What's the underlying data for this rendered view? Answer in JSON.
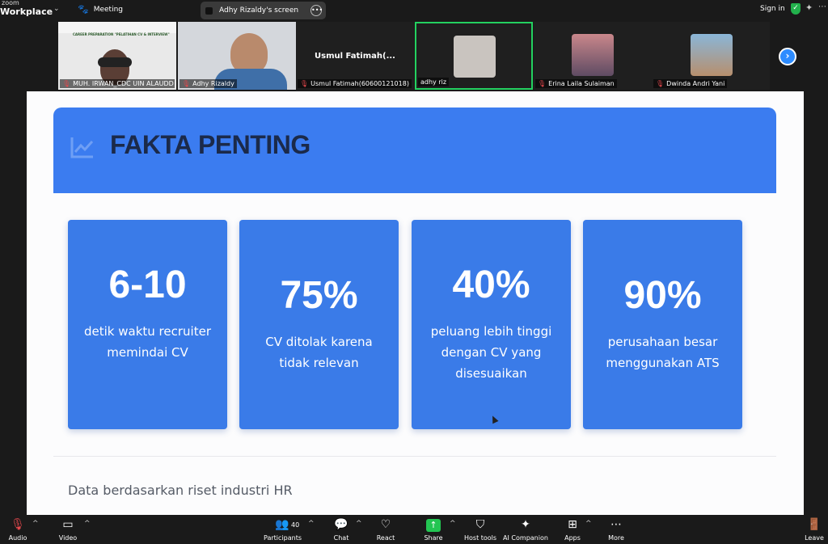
{
  "app": {
    "brand_line1": "zoom",
    "brand_line2": "Workplace",
    "meeting_label": "Meeting",
    "screen_label": "Adhy Rizaldy's screen",
    "sign_in": "Sign in"
  },
  "gallery": {
    "tiles": [
      {
        "name": "MUH. IRWAN_CDC UIN ALAUDD N"
      },
      {
        "name": "Adhy Rizaldy"
      },
      {
        "name": "Usmul Fatimah(60600121018)",
        "big_name": "Usmul Fatimah(..."
      },
      {
        "name": "adhy riz"
      },
      {
        "name": "Erina Laila Sulaiman"
      },
      {
        "name": "Dwinda Andri Yani"
      }
    ],
    "tile1_banner": "CAREER PREPARATION \"PELATIHAN CV & INTERVIEW\""
  },
  "slide": {
    "title": "FAKTA PENTING",
    "cards": [
      {
        "value": "6-10",
        "desc": "detik waktu recruiter memindai CV"
      },
      {
        "value": "75%",
        "desc": "CV ditolak karena tidak relevan"
      },
      {
        "value": "40%",
        "desc": "peluang lebih tinggi dengan CV yang disesuaikan"
      },
      {
        "value": "90%",
        "desc": "perusahaan besar menggunakan ATS"
      }
    ],
    "footnote": "Data berdasarkan riset industri HR"
  },
  "toolbar": {
    "audio": "Audio",
    "video": "Video",
    "participants": "Participants",
    "participants_count": "40",
    "chat": "Chat",
    "react": "React",
    "share": "Share",
    "host_tools": "Host tools",
    "ai_companion": "AI Companion",
    "apps": "Apps",
    "more": "More",
    "leave": "Leave"
  },
  "colors": {
    "accent": "#3b7cf0",
    "card": "#3a7be8",
    "active_tile": "#23d160",
    "share": "#23c552",
    "muted": "#e5484d"
  }
}
